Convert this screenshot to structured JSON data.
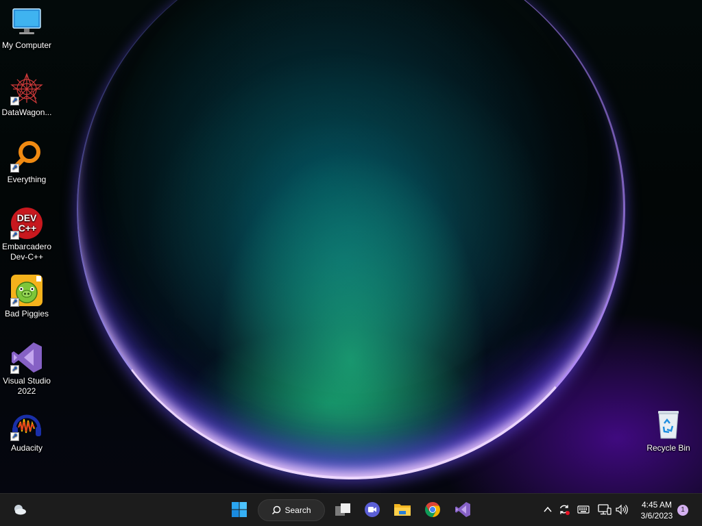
{
  "desktop": {
    "icons": [
      {
        "label": "My Computer",
        "icon": "monitor-icon"
      },
      {
        "label": "DataWagon...",
        "icon": "datawagon-icon"
      },
      {
        "label": "Everything",
        "icon": "magnifier-icon"
      },
      {
        "label": "Embarcadero Dev-C++",
        "icon": "devcpp-icon",
        "logo_text": "DEV C++"
      },
      {
        "label": "Bad Piggies",
        "icon": "bad-piggies-icon"
      },
      {
        "label": "Visual Studio 2022",
        "icon": "visual-studio-icon"
      },
      {
        "label": "Audacity",
        "icon": "audacity-icon"
      }
    ],
    "recycle_bin": {
      "label": "Recycle Bin",
      "icon": "recycle-bin-icon"
    }
  },
  "taskbar": {
    "search_label": "Search",
    "apps": [
      "start-icon",
      "task-view-icon",
      "teams-chat-icon",
      "file-explorer-icon",
      "chrome-icon",
      "visual-studio-icon"
    ],
    "tray": [
      "chevron-up-icon",
      "sync-icon",
      "keyboard-icon",
      "network-icon",
      "volume-icon"
    ],
    "clock": {
      "time": "4:45 AM",
      "date": "3/6/2023"
    },
    "notification_count": "1"
  },
  "colors": {
    "taskbar_bg": "#1c1c1c",
    "accent_blue": "#0078d4",
    "notification_badge": "#d4b0f0"
  }
}
